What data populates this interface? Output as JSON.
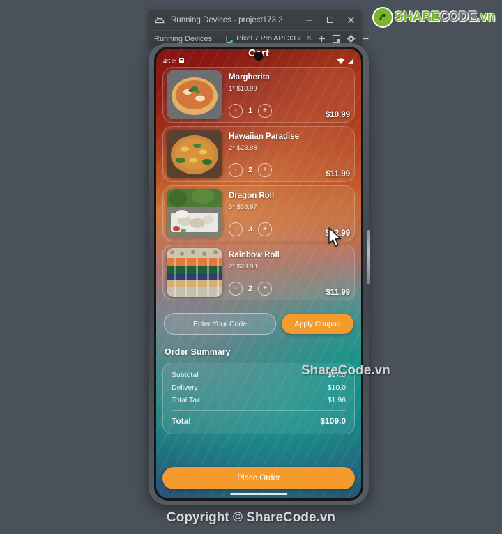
{
  "brand": {
    "logo_icon": "sharecode-logo-icon",
    "share": "SHARE",
    "code": "CODE",
    "vn": ".vn",
    "green": "#76b82a",
    "gray": "#6d6e71"
  },
  "ide": {
    "app_icon": "android-studio-icon",
    "title": "Running Devices - project173.2",
    "minimize_icon": "minimize-icon",
    "maximize_icon": "maximize-icon",
    "close_icon": "close-icon",
    "toolbar_label": "Running Devices:",
    "device_tab": {
      "icon": "device-phone-icon",
      "name": "Pixel 7 Pro API 33 2",
      "close_icon": "tab-close-icon"
    },
    "actions": [
      {
        "name": "add-device-button",
        "icon": "plus-icon",
        "glyph": "+"
      },
      {
        "name": "layout-button",
        "icon": "panel-layout-icon"
      },
      {
        "name": "settings-button",
        "icon": "gear-icon"
      },
      {
        "name": "minimize-panel-button",
        "icon": "minus-icon",
        "glyph": "−"
      }
    ]
  },
  "phone": {
    "statusbar": {
      "time": "4:35",
      "alarm_icon": "alarm-icon",
      "wifi_icon": "wifi-icon",
      "signal_icon": "signal-icon"
    },
    "app": {
      "title": "Cart",
      "cart_items": [
        {
          "name": "Margherita",
          "subtitle": "1* $10.99",
          "quantity": "1",
          "price": "$10.99",
          "thumb": "pizza-margherita-photo",
          "minus": "-",
          "plus": "+"
        },
        {
          "name": "Hawaiian Paradise",
          "subtitle": "2* $23.98",
          "quantity": "2",
          "price": "$11.99",
          "thumb": "pizza-hawaiian-photo",
          "minus": "-",
          "plus": "+"
        },
        {
          "name": "Dragon Roll",
          "subtitle": "3* $38.97",
          "quantity": "3",
          "price": "$12.99",
          "thumb": "sushi-dragon-roll-photo",
          "minus": "-",
          "plus": "+"
        },
        {
          "name": "Rainbow Roll",
          "subtitle": "2* $23.98",
          "quantity": "2",
          "price": "$11.99",
          "thumb": "sushi-rainbow-roll-photo",
          "minus": "-",
          "plus": "+"
        }
      ],
      "coupon": {
        "placeholder": "Enter Your Code",
        "value": "",
        "apply_label": "Apply Coupon"
      },
      "summary": {
        "title": "Order Summary",
        "rows": [
          {
            "label": "Subtotal",
            "value": "$97.0"
          },
          {
            "label": "Delivery",
            "value": "$10.0"
          },
          {
            "label": "Total Tax",
            "value": "$1.96"
          }
        ],
        "total_label": "Total",
        "total_value": "$109.0"
      },
      "place_order_label": "Place Order",
      "accent_orange": "#f59b2e"
    }
  },
  "watermarks": {
    "center": "ShareCode.vn",
    "bottom": "Copyright © ShareCode.vn"
  },
  "cursor": {
    "icon": "mouse-pointer-icon"
  }
}
